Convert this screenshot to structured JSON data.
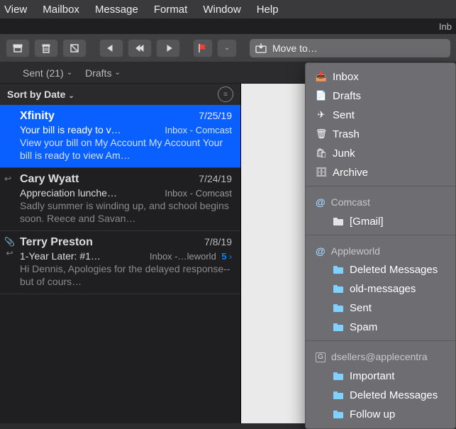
{
  "menubar": [
    "View",
    "Mailbox",
    "Message",
    "Format",
    "Window",
    "Help"
  ],
  "window": {
    "title_fragment": "Inb"
  },
  "toolbar": {
    "moveto_label": "Move to…"
  },
  "favorites": {
    "sent": {
      "label": "Sent",
      "count": "(21)"
    },
    "drafts": {
      "label": "Drafts"
    }
  },
  "sortbar": {
    "label": "Sort by Date"
  },
  "messages": [
    {
      "sender": "Xfinity",
      "date": "7/25/19",
      "subject": "Your bill is ready to v…",
      "mailbox": "Inbox - Comcast",
      "snippet": "View your bill on My Account My Account Your bill is ready to view Am…",
      "selected": true
    },
    {
      "sender": "Cary Wyatt",
      "date": "7/24/19",
      "subject": "Appreciation lunche…",
      "mailbox": "Inbox - Comcast",
      "snippet": "Sadly summer is winding up, and school begins soon. Reece and Savan…",
      "reply": true
    },
    {
      "sender": "Terry Preston",
      "date": "7/8/19",
      "subject": "1-Year Later: #1…",
      "mailbox": "Inbox -…leworld",
      "snippet": "Hi Dennis, Apologies for the delayed response-- but of cours…",
      "attachment": true,
      "reply": true,
      "thread_count": "5"
    }
  ],
  "dropdown": {
    "top": [
      {
        "icon": "inbox",
        "label": "Inbox"
      },
      {
        "icon": "drafts",
        "label": "Drafts"
      },
      {
        "icon": "sent",
        "label": "Sent"
      },
      {
        "icon": "trash",
        "label": "Trash"
      },
      {
        "icon": "junk",
        "label": "Junk"
      },
      {
        "icon": "archive",
        "label": "Archive"
      }
    ],
    "sections": [
      {
        "name": "Comcast",
        "icon": "at",
        "children": [
          {
            "icon": "folderw",
            "label": "[Gmail]"
          }
        ]
      },
      {
        "name": "Appleworld",
        "icon": "at",
        "children": [
          {
            "icon": "folder",
            "label": "Deleted Messages"
          },
          {
            "icon": "folder",
            "label": "old-messages"
          },
          {
            "icon": "folder",
            "label": "Sent"
          },
          {
            "icon": "folder",
            "label": "Spam"
          }
        ]
      },
      {
        "name": "dsellers@applecentra",
        "icon": "g",
        "children": [
          {
            "icon": "folder",
            "label": "Important"
          },
          {
            "icon": "folder",
            "label": "Deleted Messages"
          },
          {
            "icon": "folder",
            "label": "Follow up"
          }
        ]
      }
    ]
  }
}
